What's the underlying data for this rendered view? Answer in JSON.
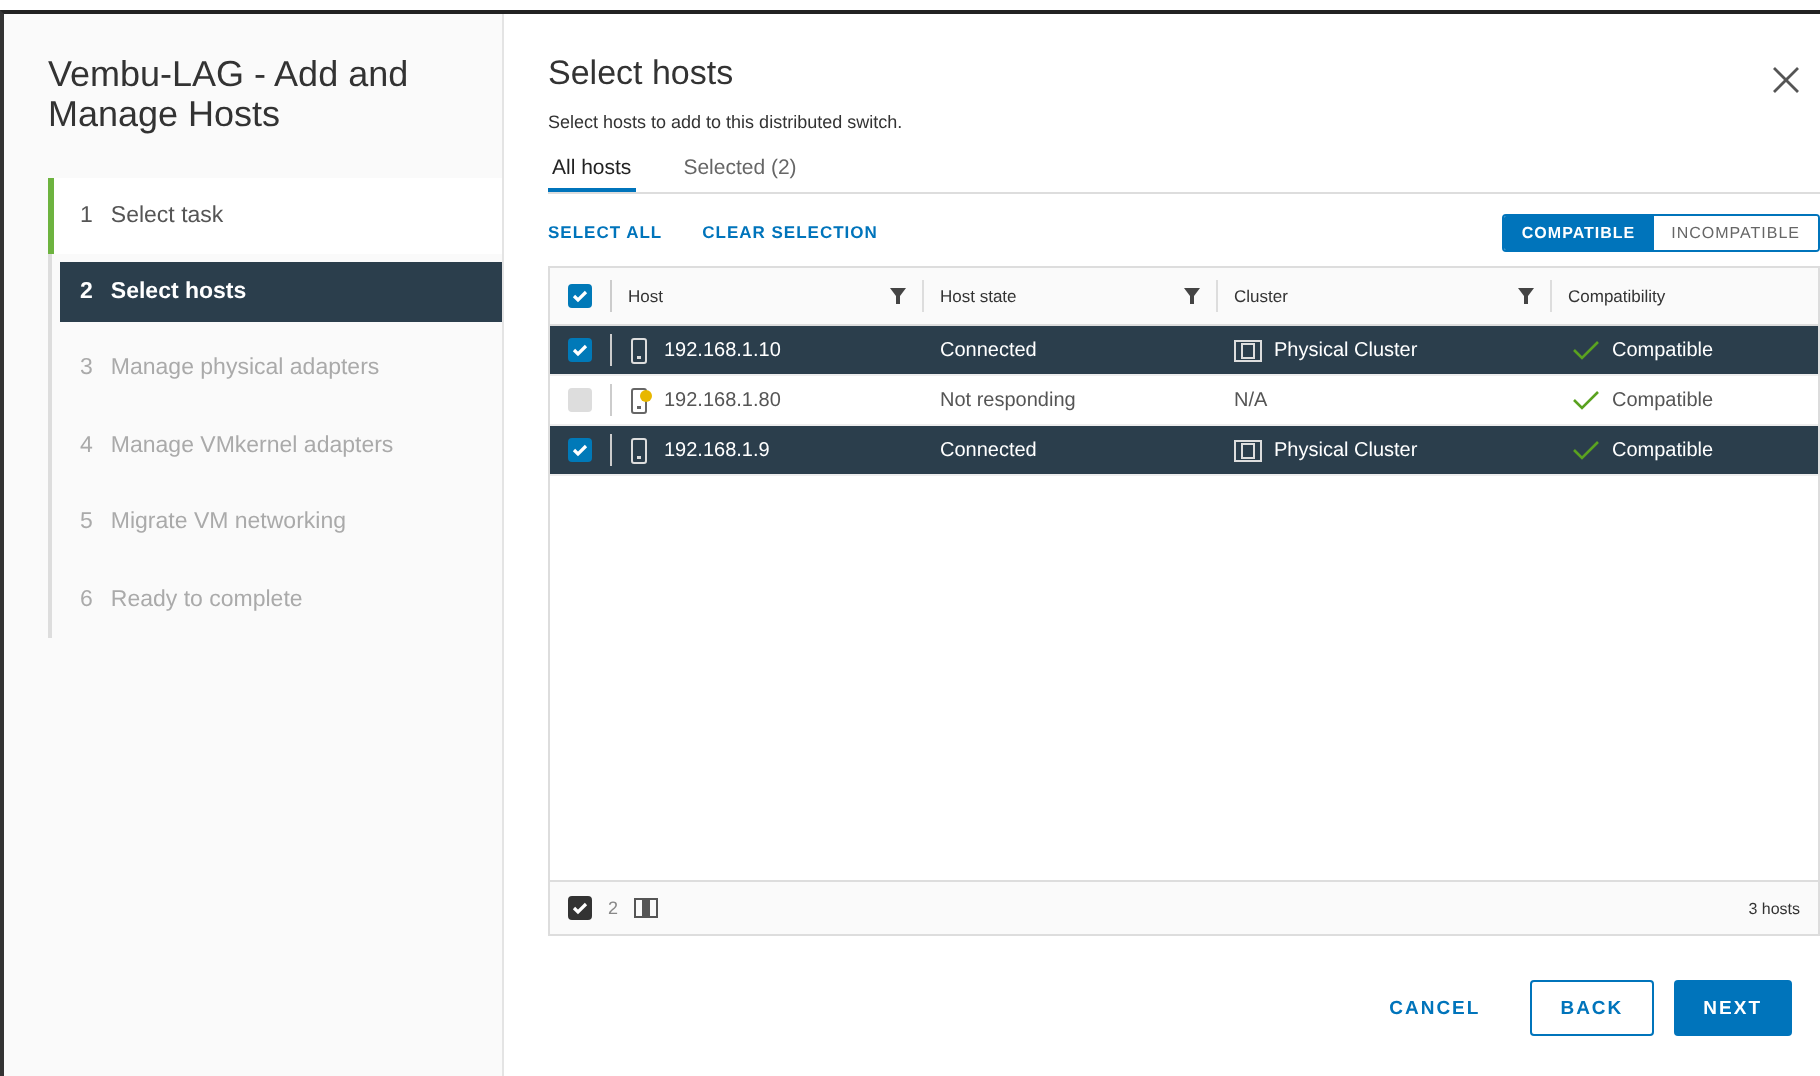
{
  "sidebar": {
    "title": "Vembu-LAG - Add and Manage Hosts",
    "steps": [
      {
        "number": "1",
        "label": "Select task",
        "kind": "done"
      },
      {
        "number": "2",
        "label": "Select hosts",
        "kind": "current"
      },
      {
        "number": "3",
        "label": "Manage physical adapters",
        "kind": "pending"
      },
      {
        "number": "4",
        "label": "Manage VMkernel adapters",
        "kind": "pending"
      },
      {
        "number": "5",
        "label": "Migrate VM networking",
        "kind": "pending"
      },
      {
        "number": "6",
        "label": "Ready to complete",
        "kind": "pending"
      }
    ]
  },
  "header": {
    "title": "Select hosts",
    "subtitle": "Select hosts to add to this distributed switch."
  },
  "tabs": [
    {
      "label": "All hosts",
      "selected": true
    },
    {
      "label": "Selected (2)",
      "selected": false
    }
  ],
  "actions": [
    "SELECT ALL",
    "CLEAR SELECTION"
  ],
  "filter": [
    {
      "label": "COMPATIBLE",
      "selected": true
    },
    {
      "label": "INCOMPATIBLE",
      "selected": false
    }
  ],
  "table": {
    "all_checked": true,
    "columns": [
      {
        "label": "Host",
        "filter": true
      },
      {
        "label": "Host state",
        "filter": true
      },
      {
        "label": "Cluster",
        "filter": true
      },
      {
        "label": "Compatibility",
        "filter": false
      }
    ],
    "rows": [
      {
        "host": "192.168.1.10",
        "warning": false,
        "state": "Connected",
        "cluster": "Physical Cluster",
        "has_cluster": true,
        "compatibility": "Compatible",
        "selected": true,
        "disabled": false
      },
      {
        "host": "192.168.1.80",
        "warning": true,
        "state": "Not responding",
        "cluster": "N/A",
        "has_cluster": false,
        "compatibility": "Compatible",
        "selected": false,
        "disabled": true
      },
      {
        "host": "192.168.1.9",
        "warning": false,
        "state": "Connected",
        "cluster": "Physical Cluster",
        "has_cluster": true,
        "compatibility": "Compatible",
        "selected": true,
        "disabled": false
      }
    ],
    "footer": {
      "selected_count": "2",
      "total": "3 hosts"
    }
  },
  "buttons": [
    {
      "label": "CANCEL",
      "kind": "flat"
    },
    {
      "label": "BACK",
      "kind": "outline"
    },
    {
      "label": "NEXT",
      "kind": "primary"
    }
  ]
}
